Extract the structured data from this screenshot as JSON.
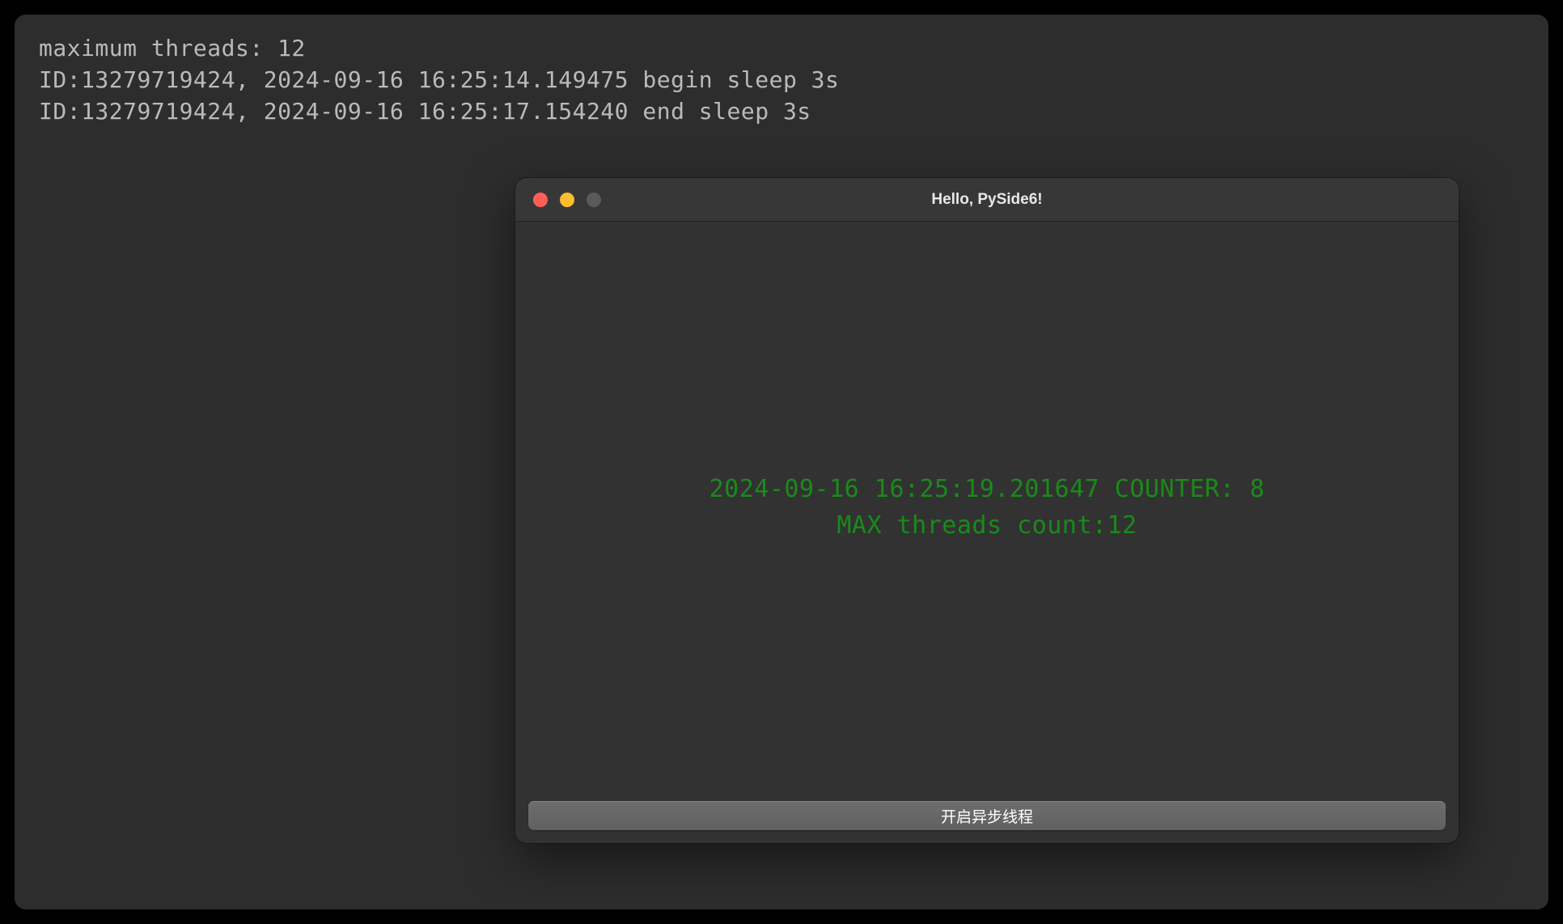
{
  "terminal": {
    "lines": [
      "maximum threads: 12",
      "ID:13279719424, 2024-09-16 16:25:14.149475 begin sleep 3s",
      "ID:13279719424, 2024-09-16 16:25:17.154240 end sleep 3s"
    ]
  },
  "window": {
    "title": "Hello, PySide6!",
    "status_line1": "2024-09-16 16:25:19.201647 COUNTER: 8",
    "status_line2": "MAX threads count:12",
    "button_label": "开启异步线程"
  },
  "colors": {
    "terminal_bg": "#2d2d2d",
    "terminal_text": "#bababa",
    "window_bg": "#323232",
    "status_text": "#1a8a1a",
    "traffic_close": "#ff5f57",
    "traffic_minimize": "#febc2e"
  }
}
